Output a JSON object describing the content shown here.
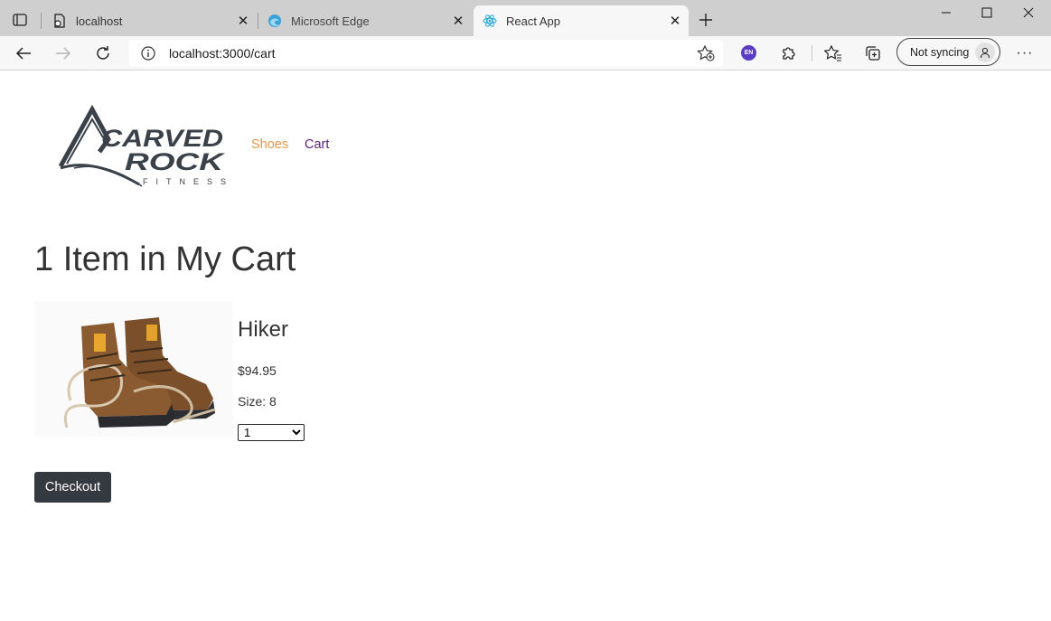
{
  "browser": {
    "tabs": [
      {
        "title": "localhost",
        "icon": "page-icon",
        "active": false
      },
      {
        "title": "Microsoft Edge",
        "icon": "edge-icon",
        "active": false
      },
      {
        "title": "React App",
        "icon": "react-icon",
        "active": true
      }
    ],
    "address": {
      "url": "localhost:3000/cart"
    },
    "profile_label": "Not syncing",
    "language_badge": "EN"
  },
  "site": {
    "logo_text": "CARVED ROCK FITNESS",
    "nav": [
      {
        "label": "Shoes",
        "color": "#e8964a"
      },
      {
        "label": "Cart",
        "color": "#5a1f7a"
      }
    ]
  },
  "cart": {
    "heading": "1 Item in My Cart",
    "items": [
      {
        "name": "Hiker",
        "price": "$94.95",
        "size_label": "Size: 8",
        "quantity": "1"
      }
    ],
    "quantity_options": [
      "1"
    ],
    "checkout_label": "Checkout",
    "checkout_color": "#343a40"
  }
}
